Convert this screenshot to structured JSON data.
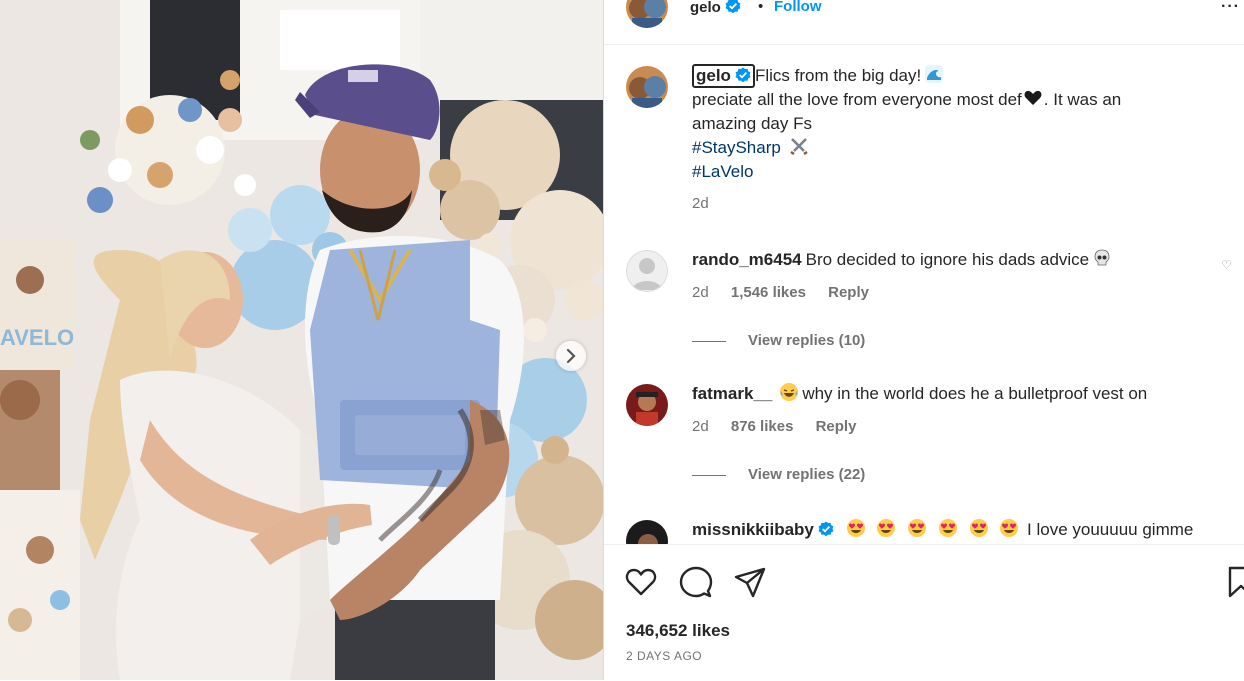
{
  "post": {
    "username": "gelo",
    "follow_label": "Follow",
    "more_label": "···",
    "header_separator": "•"
  },
  "caption": {
    "username": "gelo",
    "text_line1": "Flics from the big day!",
    "text_line2": "preciate all the love from everyone most def",
    "text_line2_end": ". It was an",
    "text_line3": "amazing day Fs",
    "hashtag1": "#StaySharp",
    "hashtag2": "#LaVelo",
    "time": "2d"
  },
  "comments": [
    {
      "username": "rando_m6454",
      "text": "Bro decided to ignore his dads advice",
      "time": "2d",
      "likes": "1,546 likes",
      "reply_label": "Reply",
      "view_replies": "View replies (10)"
    },
    {
      "username": "fatmark__",
      "text": "why in the world does he a bulletproof vest on",
      "time": "2d",
      "likes": "876 likes",
      "reply_label": "Reply",
      "view_replies": "View replies (22)"
    },
    {
      "username": "missnikkiibaby",
      "text": "I love youuuuu gimme"
    }
  ],
  "footer": {
    "likes": "346,652 likes",
    "date": "2 DAYS AGO"
  },
  "icons": {
    "heart": "heart-icon",
    "comment": "comment-icon",
    "share": "share-icon",
    "save": "save-icon",
    "verified": "verified-badge-icon",
    "carousel_next": "chevron-right-icon"
  },
  "colors": {
    "link_blue": "#0095f6",
    "hashtag": "#00376b",
    "muted": "#737373",
    "verified": "#0095f6"
  }
}
